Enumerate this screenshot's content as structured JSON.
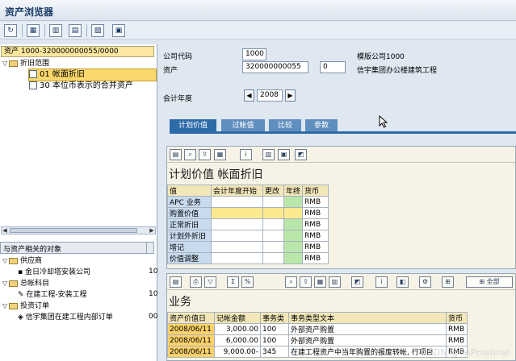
{
  "window": {
    "title": "资产浏览器"
  },
  "toolbar": {
    "buttons": [
      "refresh-icon",
      "grid-icon",
      "chart-icon",
      "layout-icon",
      "multi-icon",
      "table-icon"
    ],
    "glyphs": [
      "↻",
      "▦",
      "▥",
      "▤",
      "▧",
      "▣"
    ]
  },
  "left": {
    "asset_header": "资产 1000-320000000055/0000",
    "tree": {
      "root": "折旧范围",
      "items": [
        {
          "code": "01",
          "label": "帐面折旧"
        },
        {
          "code": "30",
          "label": "本位币表示的合并资产"
        }
      ]
    },
    "related": {
      "header": "与资产相关的对象",
      "groups": [
        {
          "label": "供应商",
          "child": "金日冷却塔安装公司",
          "value": "10"
        },
        {
          "label": "总帐科目",
          "child": "在建工程-安装工程",
          "value": "10"
        },
        {
          "label": "投资订单",
          "child": "信宇集团在建工程内部订单",
          "value": "00"
        }
      ]
    }
  },
  "header": {
    "company_code_label": "公司代码",
    "company_code": "1000",
    "company_name": "模版公司1000",
    "asset_label": "资产",
    "asset_number": "320000000055",
    "sub_number": "0",
    "asset_desc": "信宇集团办公楼建筑工程",
    "fiscal_year_label": "会计年度",
    "fiscal_year": "2008"
  },
  "tabs": [
    "计划价值",
    "过帐值",
    "比较",
    "参数"
  ],
  "planned": {
    "title": "计划价值 帐面折旧",
    "columns": [
      "值",
      "会计年度开始",
      "更改",
      "年终",
      "货币"
    ],
    "rows": [
      {
        "label": "APC 业务",
        "currency": "RMB"
      },
      {
        "label": "购置价值",
        "currency": "RMB"
      },
      {
        "label": "正常折旧",
        "currency": "RMB"
      },
      {
        "label": "计划外折旧",
        "currency": "RMB"
      },
      {
        "label": "增记",
        "currency": "RMB"
      },
      {
        "label": "价值调整",
        "currency": "RMB"
      }
    ]
  },
  "transactions": {
    "title": "业务",
    "toolbar_all_label": "全部",
    "columns": [
      "资产价值日",
      "记帐金额",
      "事务类",
      "事务类型文本",
      "货币"
    ],
    "rows": [
      {
        "date": "2008/06/11",
        "amount": "3,000.00",
        "type": "100",
        "text": "外部资产购置",
        "currency": "RMB"
      },
      {
        "date": "2008/06/11",
        "amount": "6,000.00",
        "type": "100",
        "text": "外部资产购置",
        "currency": "RMB"
      },
      {
        "date": "2008/06/11",
        "amount": "9,000.00-",
        "type": "345",
        "text": "在建工程资产中当年购置的报废转帐, 行项目",
        "currency": "RMB"
      }
    ]
  },
  "watermark": "CSDN @SAPmatinal",
  "colors": {
    "accent": "#2d6aa8",
    "selection": "#fad86b"
  }
}
